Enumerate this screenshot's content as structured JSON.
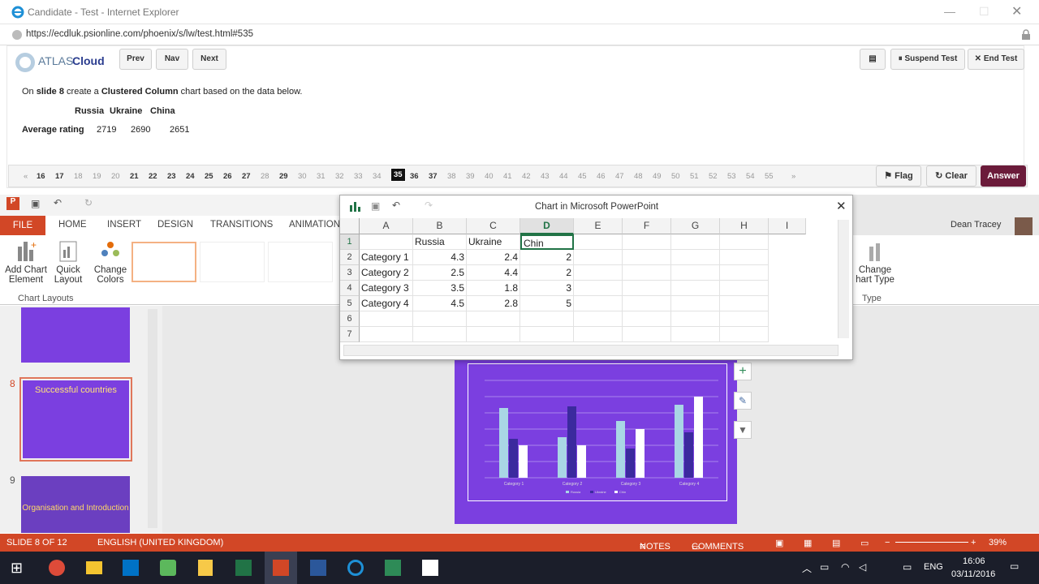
{
  "browser": {
    "title": "Candidate - Test - Internet Explorer",
    "url": "https://ecdluk.psionline.com/phoenix/s/lw/test.html#535"
  },
  "test": {
    "logo_atlas": "ATLAS",
    "logo_cloud": "Cloud",
    "prev": "Prev",
    "nav": "Nav",
    "next": "Next",
    "suspend": "Suspend Test",
    "end": "End Test",
    "instruction_pre": "On ",
    "instruction_slide": "slide 8",
    "instruction_mid": " create a ",
    "instruction_chart": "Clustered Column",
    "instruction_post": " chart based on the data below.",
    "table_headers": [
      "Russia",
      "Ukraine",
      "China"
    ],
    "row_label": "Average rating",
    "row_values": [
      "2719",
      "2690",
      "2651"
    ],
    "first": "«",
    "last": "»",
    "flag": "Flag",
    "clear": "Clear",
    "answer": "Answer"
  },
  "questions": [
    {
      "n": "16",
      "b": true
    },
    {
      "n": "17",
      "b": true
    },
    {
      "n": "18",
      "b": false
    },
    {
      "n": "19",
      "b": false
    },
    {
      "n": "20",
      "b": false
    },
    {
      "n": "21",
      "b": true
    },
    {
      "n": "22",
      "b": true
    },
    {
      "n": "23",
      "b": true
    },
    {
      "n": "24",
      "b": true
    },
    {
      "n": "25",
      "b": true
    },
    {
      "n": "26",
      "b": true
    },
    {
      "n": "27",
      "b": true
    },
    {
      "n": "28",
      "b": false
    },
    {
      "n": "29",
      "b": true
    },
    {
      "n": "30",
      "b": false
    },
    {
      "n": "31",
      "b": false
    },
    {
      "n": "32",
      "b": false
    },
    {
      "n": "33",
      "b": false
    },
    {
      "n": "34",
      "b": false
    },
    {
      "n": "35",
      "b": true,
      "current": true
    },
    {
      "n": "36",
      "b": true
    },
    {
      "n": "37",
      "b": true
    },
    {
      "n": "38",
      "b": false
    },
    {
      "n": "39",
      "b": false
    },
    {
      "n": "40",
      "b": false
    },
    {
      "n": "41",
      "b": false
    },
    {
      "n": "42",
      "b": false
    },
    {
      "n": "43",
      "b": false
    },
    {
      "n": "44",
      "b": false
    },
    {
      "n": "45",
      "b": false
    },
    {
      "n": "46",
      "b": false
    },
    {
      "n": "47",
      "b": false
    },
    {
      "n": "48",
      "b": false
    },
    {
      "n": "49",
      "b": false
    },
    {
      "n": "50",
      "b": false
    },
    {
      "n": "51",
      "b": false
    },
    {
      "n": "52",
      "b": false
    },
    {
      "n": "53",
      "b": false
    },
    {
      "n": "54",
      "b": false
    },
    {
      "n": "55",
      "b": false
    }
  ],
  "ppt": {
    "tabs": [
      "FILE",
      "HOME",
      "INSERT",
      "DESIGN",
      "TRANSITIONS",
      "ANIMATION"
    ],
    "user": "Dean Tracey",
    "add_chart": "Add Chart",
    "element": "Element",
    "quick": "Quick",
    "layout": "Layout",
    "change": "Change",
    "colors": "Colors",
    "group": "Chart Layouts",
    "change_type_1": "Change",
    "change_type_2": "hart Type",
    "type_group": "Type",
    "slide8_num": "8",
    "slide8_title": "Successful countries",
    "slide9_num": "9",
    "slide9_title": "Organisation and Introduction",
    "status_slide": "SLIDE 8 OF 12",
    "status_lang": "ENGLISH (UNITED KINGDOM)",
    "notes": "NOTES",
    "comments": "COMMENTS",
    "zoom": "39%"
  },
  "excel": {
    "title": "Chart in Microsoft PowerPoint",
    "cols": [
      "A",
      "B",
      "C",
      "D",
      "E",
      "F",
      "G",
      "H",
      "I"
    ],
    "rows": [
      "1",
      "2",
      "3",
      "4",
      "5",
      "6",
      "7"
    ],
    "header": [
      "",
      "Russia",
      "Ukraine",
      "Chin"
    ],
    "data": [
      [
        "Category 1",
        "4.3",
        "2.4",
        "2"
      ],
      [
        "Category 2",
        "2.5",
        "4.4",
        "2"
      ],
      [
        "Category 3",
        "3.5",
        "1.8",
        "3"
      ],
      [
        "Category 4",
        "4.5",
        "2.8",
        "5"
      ]
    ]
  },
  "chart_data": {
    "type": "bar",
    "categories": [
      "Category 1",
      "Category 2",
      "Category 3",
      "Category 4"
    ],
    "series": [
      {
        "name": "Russia",
        "values": [
          4.3,
          2.5,
          3.5,
          4.5
        ]
      },
      {
        "name": "Ukraine",
        "values": [
          2.4,
          4.4,
          1.8,
          2.8
        ]
      },
      {
        "name": "Chin",
        "values": [
          2,
          2,
          3,
          5
        ]
      }
    ],
    "ylim": [
      0,
      6
    ],
    "colors": [
      "#a9d6e5",
      "#3b2a9e",
      "#ffffff"
    ],
    "grid": true,
    "legend": "bottom"
  },
  "taskbar": {
    "lang": "ENG",
    "time": "16:06",
    "date": "03/11/2016"
  }
}
